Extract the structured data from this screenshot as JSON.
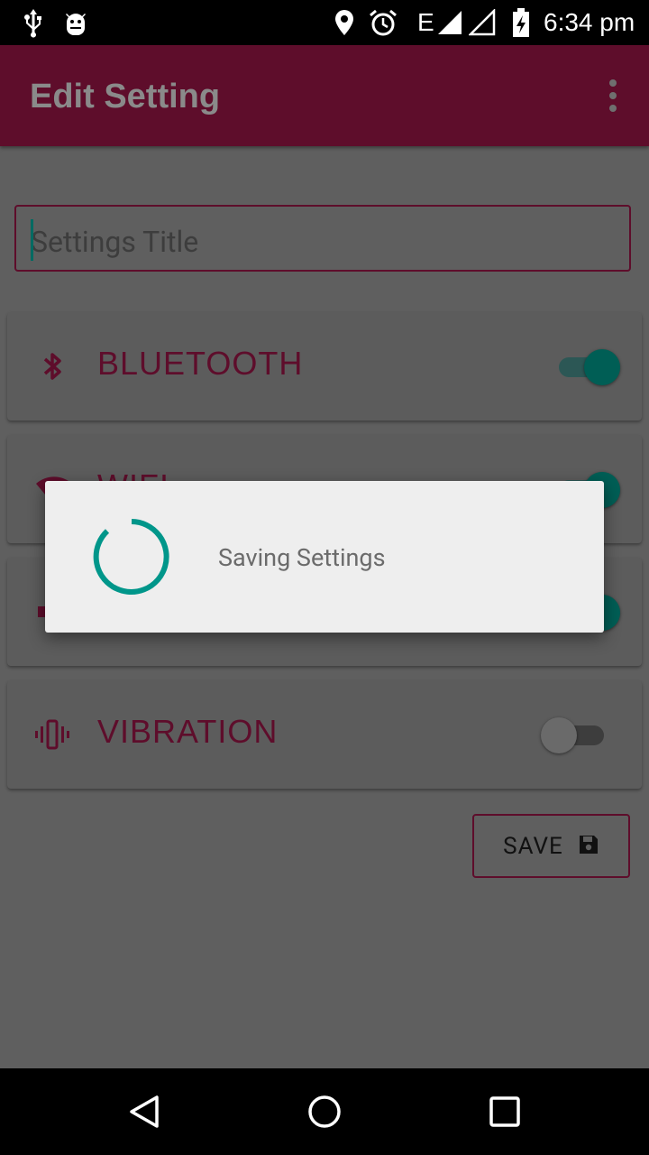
{
  "status_bar": {
    "time": "6:34 pm",
    "network": "E",
    "icons": [
      "usb-icon",
      "android-debug-icon",
      "location-icon",
      "alarm-icon",
      "signal-icon",
      "signal-empty-icon",
      "battery-charging-icon"
    ]
  },
  "app_bar": {
    "title": "Edit Setting",
    "menu_icon": "overflow-menu-icon"
  },
  "title_field": {
    "placeholder": "Settings Title",
    "value": ""
  },
  "settings": [
    {
      "label": "BLUETOOTH",
      "icon": "bluetooth-icon",
      "enabled": true
    },
    {
      "label": "WIFI",
      "icon": "wifi-icon",
      "enabled": true
    },
    {
      "label": "",
      "icon": "volume-icon",
      "enabled": true
    },
    {
      "label": "VIBRATION",
      "icon": "vibration-icon",
      "enabled": false
    }
  ],
  "save_button": {
    "label": "SAVE",
    "icon": "floppy-disk-icon"
  },
  "dialog": {
    "message": "Saving Settings",
    "spinner_color": "#00968a"
  },
  "colors": {
    "primary": "#5e0d2b",
    "accent": "#00968a",
    "scrim_background": "#5f5f5f"
  },
  "nav_bar": {
    "buttons": [
      "back-icon",
      "home-icon",
      "recents-icon"
    ]
  }
}
